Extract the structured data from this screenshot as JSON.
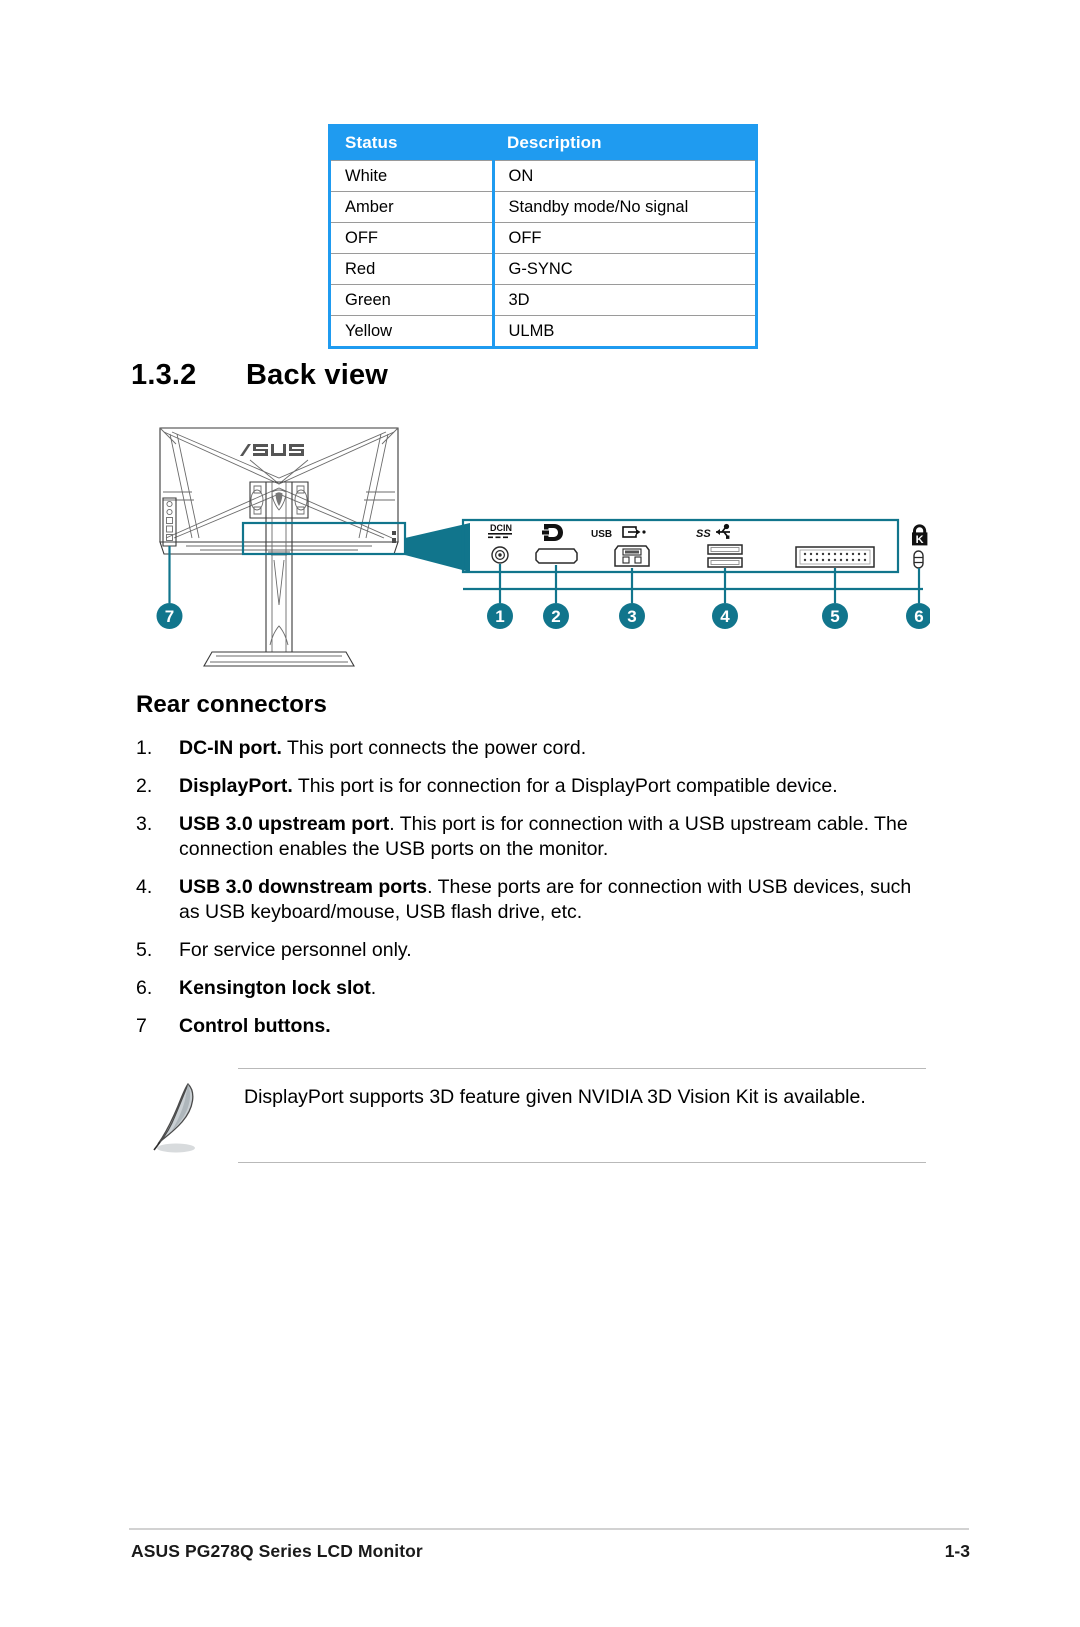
{
  "status_table": {
    "headers": [
      "Status",
      "Description"
    ],
    "rows": [
      [
        "White",
        "ON"
      ],
      [
        "Amber",
        "Standby mode/No signal"
      ],
      [
        "OFF",
        "OFF"
      ],
      [
        "Red",
        "G-SYNC"
      ],
      [
        "Green",
        "3D"
      ],
      [
        "Yellow",
        "ULMB"
      ]
    ],
    "header_bg": "#1F9BF0",
    "header_fg": "#FFFFFF"
  },
  "section": {
    "number": "1.3.2",
    "title": "Back view"
  },
  "diagram": {
    "brand_logo": "ASUS",
    "accent_color": "#11758C",
    "highlight_color": "#1A8CA8",
    "callouts": [
      "1",
      "2",
      "3",
      "4",
      "5",
      "6",
      "7"
    ],
    "port_labels": {
      "dcin": "DCIN",
      "displayport": "DP",
      "usb_upstream": "USB",
      "usb_downstream": "SS",
      "service": "",
      "kensington": "K"
    }
  },
  "rear_connectors": {
    "heading": "Rear connectors",
    "items": [
      {
        "marker": "1.",
        "bold": "DC-IN port.",
        "text": " This port connects the power cord."
      },
      {
        "marker": "2.",
        "bold": "DisplayPort.",
        "text": " This port is for connection for a DisplayPort compatible device."
      },
      {
        "marker": "3.",
        "bold": "USB 3.0 upstream port",
        "text": ". This port is for connection with a USB upstream cable. The connection enables the USB ports on the monitor."
      },
      {
        "marker": "4.",
        "bold": "USB 3.0 downstream ports",
        "text": ". These ports are for connection with USB devices, such as  USB keyboard/mouse, USB flash drive, etc."
      },
      {
        "marker": "5.",
        "bold": "",
        "text": "For service personnel only."
      },
      {
        "marker": "6.",
        "bold": "Kensington lock slot",
        "text": "."
      },
      {
        "marker": "7",
        "bold": "Control buttons.",
        "text": ""
      }
    ]
  },
  "note": {
    "icon": "quill-pen-icon",
    "text": "DisplayPort supports 3D feature given NVIDIA 3D Vision Kit is available."
  },
  "footer": {
    "left": "ASUS PG278Q Series LCD Monitor",
    "right": "1-3"
  }
}
